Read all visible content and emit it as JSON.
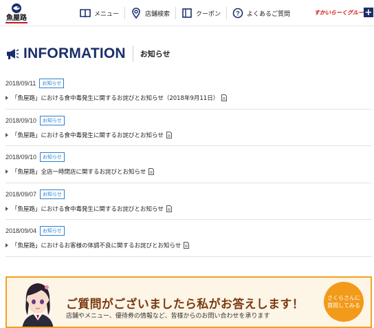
{
  "header": {
    "logo_text": "魚屋路",
    "nav": [
      {
        "label": "メニュー",
        "icon": "book-icon"
      },
      {
        "label": "店舗検索",
        "icon": "map-pin-icon"
      },
      {
        "label": "クーポン",
        "icon": "coupon-icon"
      },
      {
        "label": "よくあるご質問",
        "icon": "question-icon"
      }
    ],
    "group_logo_text": "すかいらーくグループ",
    "plus_label": "+"
  },
  "page": {
    "title_en": "INFORMATION",
    "title_ja": "お知らせ"
  },
  "news": [
    {
      "date": "2018/09/11",
      "badge": "お知らせ",
      "title": "「魚屋路」における食中毒発生に関するお詫びとお知らせ（2018年9月11日）"
    },
    {
      "date": "2018/09/10",
      "badge": "お知らせ",
      "title": "「魚屋路」における食中毒発生に関するお詫びとお知らせ"
    },
    {
      "date": "2018/09/10",
      "badge": "お知らせ",
      "title": "「魚屋路」全店一時閉店に関するお詫びとお知らせ"
    },
    {
      "date": "2018/09/07",
      "badge": "お知らせ",
      "title": "「魚屋路」における食中毒発生に関するお詫びとお知らせ"
    },
    {
      "date": "2018/09/04",
      "badge": "お知らせ",
      "title": "「魚屋路」におけるお客様の体調不良に関するお詫びとお知らせ"
    }
  ],
  "banner": {
    "headline": "ご質問がございましたら私がお答えします！",
    "subtext": "店舗やメニュー、優待券の情報など、皆様からのお問い合わせを承ります",
    "button_line1": "さくらさんに",
    "button_line2": "質問してみる"
  },
  "colors": {
    "brand_navy": "#1a2e6b",
    "badge_blue": "#2a7fd0",
    "banner_orange": "#f29a1a",
    "group_red": "#d01616"
  }
}
